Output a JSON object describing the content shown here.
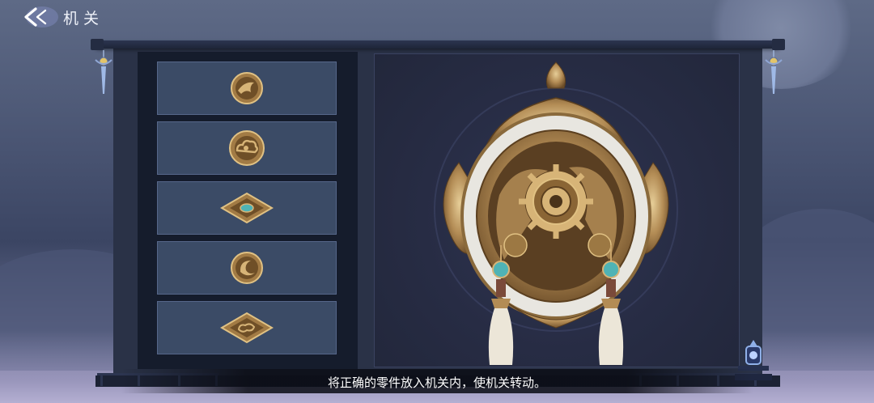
{
  "header": {
    "title": "机关",
    "back_icon": "double-chevron-left-icon"
  },
  "parts": [
    {
      "icon": "bird-emblem-coin-icon"
    },
    {
      "icon": "cloud-coin-icon"
    },
    {
      "icon": "diamond-turquoise-token-icon"
    },
    {
      "icon": "crescent-coin-icon"
    },
    {
      "icon": "diamond-cloud-token-icon"
    }
  ],
  "mechanism": {
    "icon": "bronze-dragon-phoenix-gear-medallion-icon"
  },
  "caption": {
    "text": "将正确的零件放入机关内，使机关转动。"
  },
  "colors": {
    "bronze": "#b38c55",
    "turquoise": "#4fb3b5",
    "slot_bg": "#3b4b66",
    "panel_bg": "#151c2c"
  }
}
